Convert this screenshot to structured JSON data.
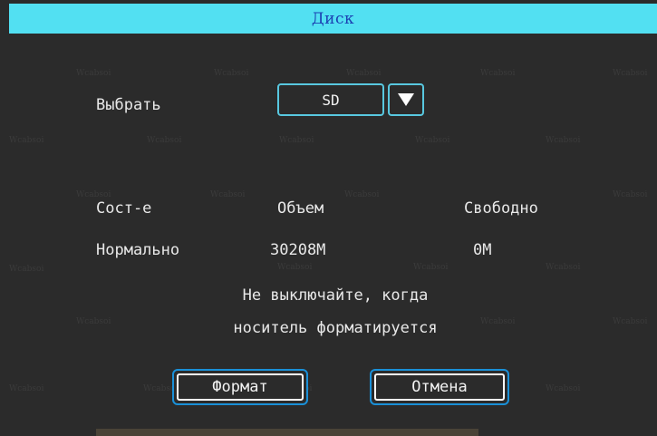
{
  "window": {
    "title": "Диск"
  },
  "watermark": {
    "text": "Wcabsoi"
  },
  "select": {
    "label": "Выбрать",
    "value": "SD",
    "arrow_icon": "triangle-down-icon"
  },
  "table": {
    "headers": [
      "Сост-е",
      "Объем",
      "Свободно"
    ],
    "row": [
      "Нормально",
      "30208M",
      "0M"
    ]
  },
  "notice": {
    "line1": "Не выключайте, когда",
    "line2": "носитель форматируется"
  },
  "buttons": {
    "format_label": "Формат",
    "cancel_label": "Отмена"
  },
  "colors": {
    "title_bar": "#52e0f2",
    "title_text": "#1b3fb2",
    "accent": "#58c8e0",
    "button_border": "#1a90d8",
    "background": "#2b2b2b"
  }
}
